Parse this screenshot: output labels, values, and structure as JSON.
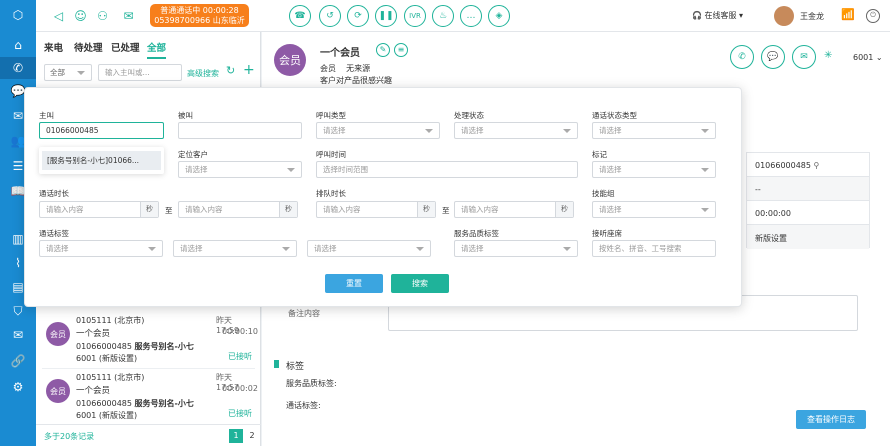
{
  "top": {
    "call_status": "普通通话中",
    "call_timer": "00:00:28",
    "call_number_area": "05398700966 山东临沂",
    "service_status": "在线客服",
    "agent_name": "王金龙",
    "call_buttons": [
      "hangup",
      "hold",
      "transfer",
      "pause",
      "IVR",
      "consult",
      "chat",
      "tag"
    ],
    "ivr_label": "IVR"
  },
  "left": {
    "tabs": [
      "来电",
      "待处理",
      "已处理",
      "全部"
    ],
    "filter_scope": "全部",
    "search_placeholder": "输入主叫或...",
    "advanced_search": "高级搜索",
    "records": [
      {
        "number": "0105111 (北京市)",
        "time": "昨天17:59",
        "name": "一个会员",
        "duration": "00:00:10",
        "phone": "01066000485",
        "alias": "服务号别名-小七",
        "agent": "6001 (新版设置)",
        "status": "已接听",
        "avatar": "会员"
      },
      {
        "number": "0105111 (北京市)",
        "time": "昨天17:57",
        "name": "一个会员",
        "duration": "00:00:02",
        "phone": "01066000485",
        "alias": "服务号别名-小七",
        "agent": "6001 (新版设置)",
        "status": "已接听",
        "avatar": "会员"
      }
    ],
    "total": "多于20条记录",
    "pages": [
      "1",
      "2"
    ]
  },
  "customer": {
    "avatar": "会员",
    "name": "一个会员",
    "type": "会员",
    "source": "无来源",
    "interest": "客户对产品很感兴趣",
    "extension": "6001"
  },
  "detail": {
    "phone": "01066000485",
    "dash": "--",
    "duration": "00:00:00",
    "setting": "新版设置",
    "remark_label": "备注内容",
    "tags_title": "标签",
    "service_tag_label": "服务品质标签:",
    "call_tag_label": "通话标签:",
    "log_button": "查看操作日志"
  },
  "search": {
    "caller_label": "主叫",
    "caller_value": "01066000485",
    "suggestion": "[服务号别名-小七]01066...",
    "callee_label": "被叫",
    "call_type_label": "呼叫类型",
    "process_label": "处理状态",
    "talk_status_label": "通话状态类型",
    "locate_label": "定位客户",
    "call_time_label": "呼叫时间",
    "mark_label": "标记",
    "talk_dur_label": "通话时长",
    "queue_dur_label": "排队时长",
    "skill_label": "技能组",
    "call_tag_label": "通话标签",
    "quality_label": "服务品质标签",
    "listen_label": "接听座席",
    "select_ph": "请选择",
    "input_ph": "请输入内容",
    "range_ph": "选择时间范围",
    "listen_ph": "按姓名、拼音、工号搜索",
    "unit": "秒",
    "to": "至",
    "reset": "重置",
    "submit": "搜索"
  },
  "colors": {
    "nav": "#1a8bd2",
    "accent": "#1fb39a",
    "orange": "#f77f1b",
    "purple": "#8e5aa6",
    "blue_btn": "#3ba5e0"
  }
}
